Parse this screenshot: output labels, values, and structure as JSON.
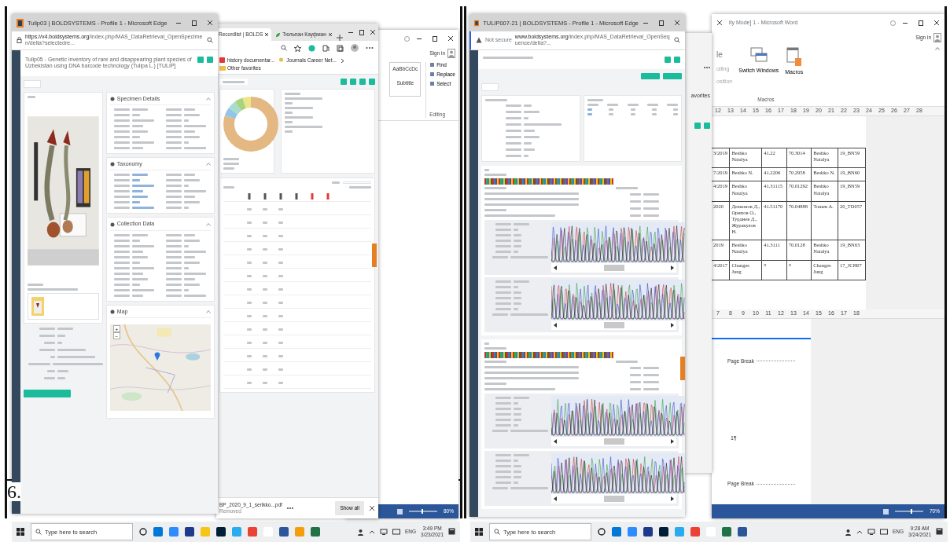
{
  "figure_label": "6.",
  "left": {
    "front_browser": {
      "title": "Tulip03 | BOLDSYSTEMS - Profile 1 - Microsoft Edge",
      "url_host": "https://v4.boldsystems.org",
      "url_path": "/index.php/MAS_DataRetrieval_OpenSpecimen/delta?selectedre...",
      "page_title": "Tulip05 - Genetic inventory of rare and disappearing plant species of Uzbekistan using DNA barcode technology (Tulipa L.) [TULIP]",
      "sections": [
        {
          "title": "Specimen Details",
          "kind": "fields",
          "links": false
        },
        {
          "title": "Taxonomy",
          "kind": "fields",
          "links": true
        },
        {
          "title": "Collection Data",
          "kind": "fields",
          "links": false
        },
        {
          "title": "Map",
          "kind": "map"
        }
      ],
      "map_zoom": [
        "+",
        "−"
      ]
    },
    "back_browser": {
      "tabs": [
        {
          "label": "Recordlist | BOLDS",
          "selected": true
        },
        {
          "label": "Тюльпан Кауфман",
          "selected": false
        }
      ],
      "favorites": [
        "history documentar...",
        "Journals Career Net...",
        "Other favorites"
      ],
      "download": {
        "file": "BP_2020_9_1_serikko...pdf",
        "status": "Removed"
      },
      "show_all": "Show all"
    },
    "word": {
      "sign_in": "Sign in",
      "style_sample": "AaBbCcDc",
      "style_name": "Subtitle",
      "editing": [
        "Find",
        "Replace",
        "Select"
      ],
      "group": "Editing",
      "zoom": "80%"
    },
    "taskbar": {
      "search": "Type here to search",
      "time": "3:49 PM",
      "date": "3/23/2021",
      "lang": "ENG"
    }
  },
  "right": {
    "browser": {
      "title": "TULIP007-21 | BOLDSYSTEMS - Profile 1 - Microsoft Edge",
      "security": "Not secure",
      "url_host": "www.boldsystems.org",
      "url_path": "/index.php/MAS_DataRetrieval_OpenSequence/delta?...",
      "sequences": [
        {
          "kind": "sequence"
        },
        {
          "kind": "sequence"
        }
      ]
    },
    "back_browser": {
      "favorites": "avorites"
    },
    "word": {
      "title": "ity Mode] 1 - Microsoft Word",
      "sign_in": "Sign in",
      "ribbon_fragments": [
        "le",
        "olling",
        "osition"
      ],
      "commands": [
        "Switch Windows",
        "Macros"
      ],
      "group": "Macros",
      "ruler": [
        "12",
        "13",
        "14",
        "15",
        "16",
        "17",
        "18",
        "19",
        "20",
        "21",
        "22",
        "23",
        "24",
        "25",
        "26",
        "27",
        "28"
      ],
      "table": [
        [
          "3/2019",
          "Beshko Natalya",
          "41.22",
          "70.3014",
          "Beshko Natalya",
          "19_BN59"
        ],
        [
          "7/2019",
          "Beshko N.",
          "41.2206",
          "70.2958",
          "Beshko N.",
          "19_BN60"
        ],
        [
          "4/2019",
          "Beshko Natalya",
          "41.31115",
          "70.01292",
          "Beshko Natalya",
          "19_BN59"
        ],
        [
          "2020",
          "Дехконов Д., Орипов О., Турдиев Д., Журакулов Н.",
          "41.51170",
          "70.04888",
          "Тошев А.",
          "20_TD057"
        ],
        [
          "2019",
          "Beshko Natalya",
          "41.3111",
          "70.0128",
          "Beshko Natalya",
          "19_BN63"
        ],
        [
          "4/2017",
          "Changes Jung",
          "¤",
          "¤",
          "Changes Jung",
          "17_JCH07"
        ]
      ],
      "ruler_2": [
        "7",
        "8",
        "9",
        "10",
        "11",
        "12",
        "13",
        "14",
        "15",
        "16",
        "17",
        "18"
      ],
      "page_breaks": [
        "Page Break",
        "Page Break"
      ],
      "paragraph_mark": "1¶",
      "zoom": "70%"
    },
    "taskbar": {
      "search": "Type here to search",
      "time": "9:28 AM",
      "date": "3/24/2021",
      "lang": "ENG"
    }
  }
}
